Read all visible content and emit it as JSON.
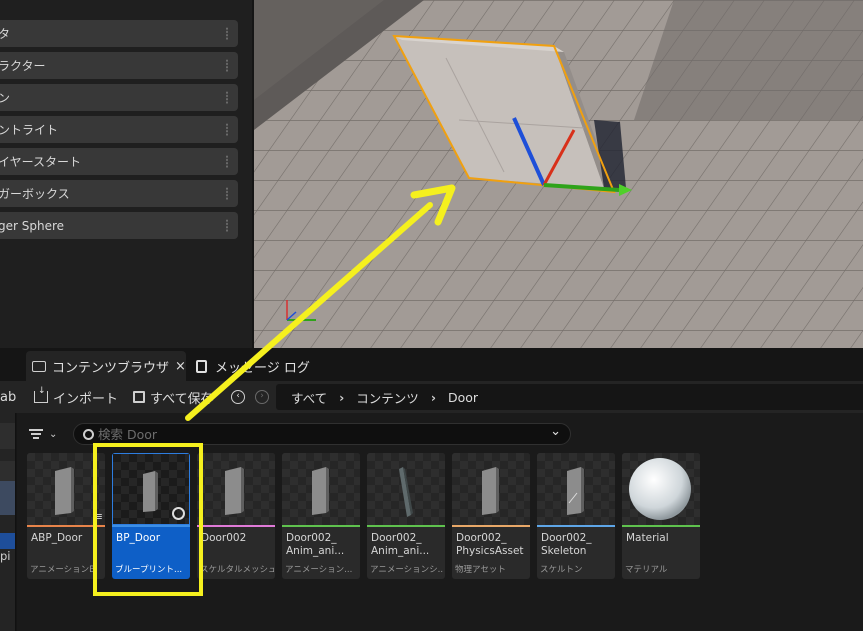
{
  "colors": {
    "accent_blue": "#0e5fc7",
    "annotation_yellow": "#f5f01e",
    "selection_orange": "#f0a010"
  },
  "place_actors": {
    "items": [
      {
        "label": "タ"
      },
      {
        "label": "ラクター"
      },
      {
        "label": "ン"
      },
      {
        "label": "ントライト"
      },
      {
        "label": "イヤースタート"
      },
      {
        "label": "ガーボックス"
      },
      {
        "label": "ger Sphere"
      }
    ]
  },
  "tabs": [
    {
      "label": "コンテンツブラウザ",
      "close": "×",
      "icon": "folder-icon"
    },
    {
      "label": "メッセージ ログ",
      "icon": "log-icon"
    }
  ],
  "toolbar": {
    "left_cut": "ab",
    "import_label": "インポート",
    "save_all_label": "すべて保存"
  },
  "breadcrumb": [
    "すべて",
    "コンテンツ",
    "Door"
  ],
  "search": {
    "placeholder": "検索 Door",
    "value": ""
  },
  "sources": {
    "cut_label": "pi"
  },
  "assets": [
    {
      "name": "ABP_Door",
      "type": "アニメーションB",
      "stripe": "#e8844a"
    },
    {
      "name": "BP_Door",
      "type": "ブループリント...",
      "stripe": "#3c8fe6",
      "selected": true
    },
    {
      "name": "Door002",
      "type": "スケルタルメッシュ",
      "stripe": "#e07ad8"
    },
    {
      "name": "Door002_\nAnim_ani...",
      "type": "アニメーション...",
      "stripe": "#5fc24e"
    },
    {
      "name": "Door002_\nAnim_ani...",
      "type": "アニメーションシ...",
      "stripe": "#5fc24e"
    },
    {
      "name": "Door002_\nPhysicsAsset",
      "type": "物理アセット",
      "stripe": "#e8a868"
    },
    {
      "name": "Door002_\nSkeleton",
      "type": "スケルトン",
      "stripe": "#5ea6e8"
    },
    {
      "name": "Material",
      "type": "マテリアル",
      "stripe": "#5fc24e"
    }
  ]
}
